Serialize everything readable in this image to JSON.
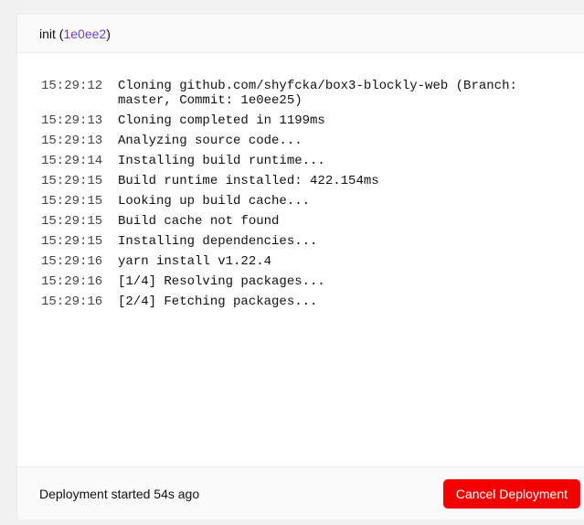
{
  "header": {
    "label": "init",
    "commit": "1e0ee2",
    "open_paren": "(",
    "close_paren": ")"
  },
  "log": [
    {
      "time": "15:29:12",
      "message": "Cloning github.com/shyfcka/box3-blockly-web (Branch:\nmaster, Commit: 1e0ee25)"
    },
    {
      "time": "15:29:13",
      "message": "Cloning completed in 1199ms"
    },
    {
      "time": "15:29:13",
      "message": "Analyzing source code..."
    },
    {
      "time": "15:29:14",
      "message": "Installing build runtime..."
    },
    {
      "time": "15:29:15",
      "message": "Build runtime installed: 422.154ms"
    },
    {
      "time": "15:29:15",
      "message": "Looking up build cache..."
    },
    {
      "time": "15:29:15",
      "message": "Build cache not found"
    },
    {
      "time": "15:29:15",
      "message": "Installing dependencies..."
    },
    {
      "time": "15:29:16",
      "message": "yarn install v1.22.4"
    },
    {
      "time": "15:29:16",
      "message": "[1/4] Resolving packages..."
    },
    {
      "time": "15:29:16",
      "message": "[2/4] Fetching packages..."
    }
  ],
  "footer": {
    "status": "Deployment started 54s ago",
    "cancel_label": "Cancel Deployment"
  }
}
